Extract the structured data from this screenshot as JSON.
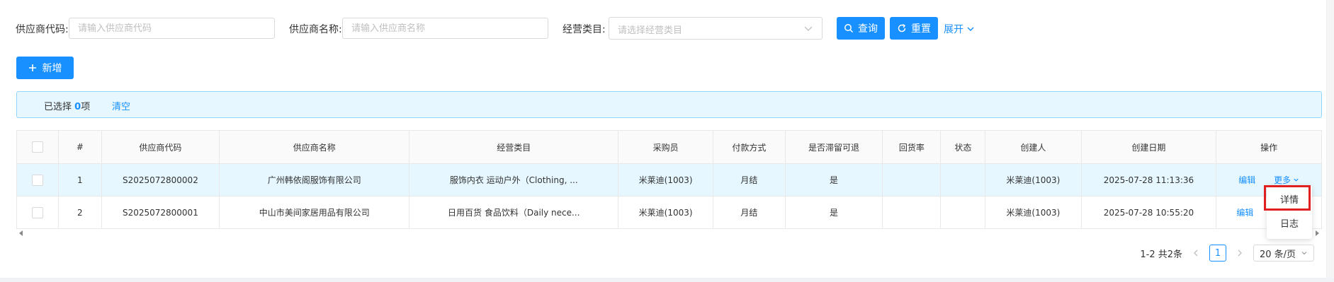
{
  "search": {
    "supplier_code_label": "供应商代码:",
    "supplier_code_placeholder": "请输入供应商代码",
    "supplier_name_label": "供应商名称:",
    "supplier_name_placeholder": "请输入供应商名称",
    "category_label": "经营类目:",
    "category_placeholder": "请选择经营类目",
    "query_label": "查询",
    "reset_label": "重置",
    "expand_label": "展开"
  },
  "toolbar": {
    "add_label": "新增"
  },
  "selection": {
    "prefix": "已选择",
    "count": "0",
    "suffix": "项",
    "clear_label": "清空"
  },
  "table": {
    "headers": [
      "#",
      "供应商代码",
      "供应商名称",
      "经营类目",
      "采购员",
      "付款方式",
      "是否滞留可退",
      "回货率",
      "状态",
      "创建人",
      "创建日期",
      "操作"
    ],
    "rows": [
      {
        "index": "1",
        "code": "S2025072800002",
        "name": "广州韩依阁服饰有限公司",
        "category": "服饰内衣 运动户外（Clothing, ...",
        "buyer": "米莱迪(1003)",
        "payment": "月结",
        "returnable": "是",
        "return_rate": "",
        "status": "",
        "creator": "米莱迪(1003)",
        "created": "2025-07-28 11:13:36",
        "edit": "编辑",
        "more": "更多"
      },
      {
        "index": "2",
        "code": "S2025072800001",
        "name": "中山市美间家居用品有限公司",
        "category": "日用百货 食品饮料（Daily nece...",
        "buyer": "米莱迪(1003)",
        "payment": "月结",
        "returnable": "是",
        "return_rate": "",
        "status": "",
        "creator": "米莱迪(1003)",
        "created": "2025-07-28 10:55:20",
        "edit": "编辑",
        "more": ""
      }
    ]
  },
  "dropdown": {
    "items": [
      "详情",
      "日志"
    ]
  },
  "pagination": {
    "summary": "1-2 共2条",
    "current": "1",
    "page_size": "20 条/页"
  },
  "colors": {
    "primary": "#1890ff",
    "highlight": "#e6f7ff",
    "alert_border": "#91d5ff",
    "focus_box": "#e02020"
  },
  "icons": [
    "search-icon",
    "reload-icon",
    "chevron-down-icon",
    "plus-icon",
    "chevron-left-icon",
    "chevron-right-icon"
  ]
}
